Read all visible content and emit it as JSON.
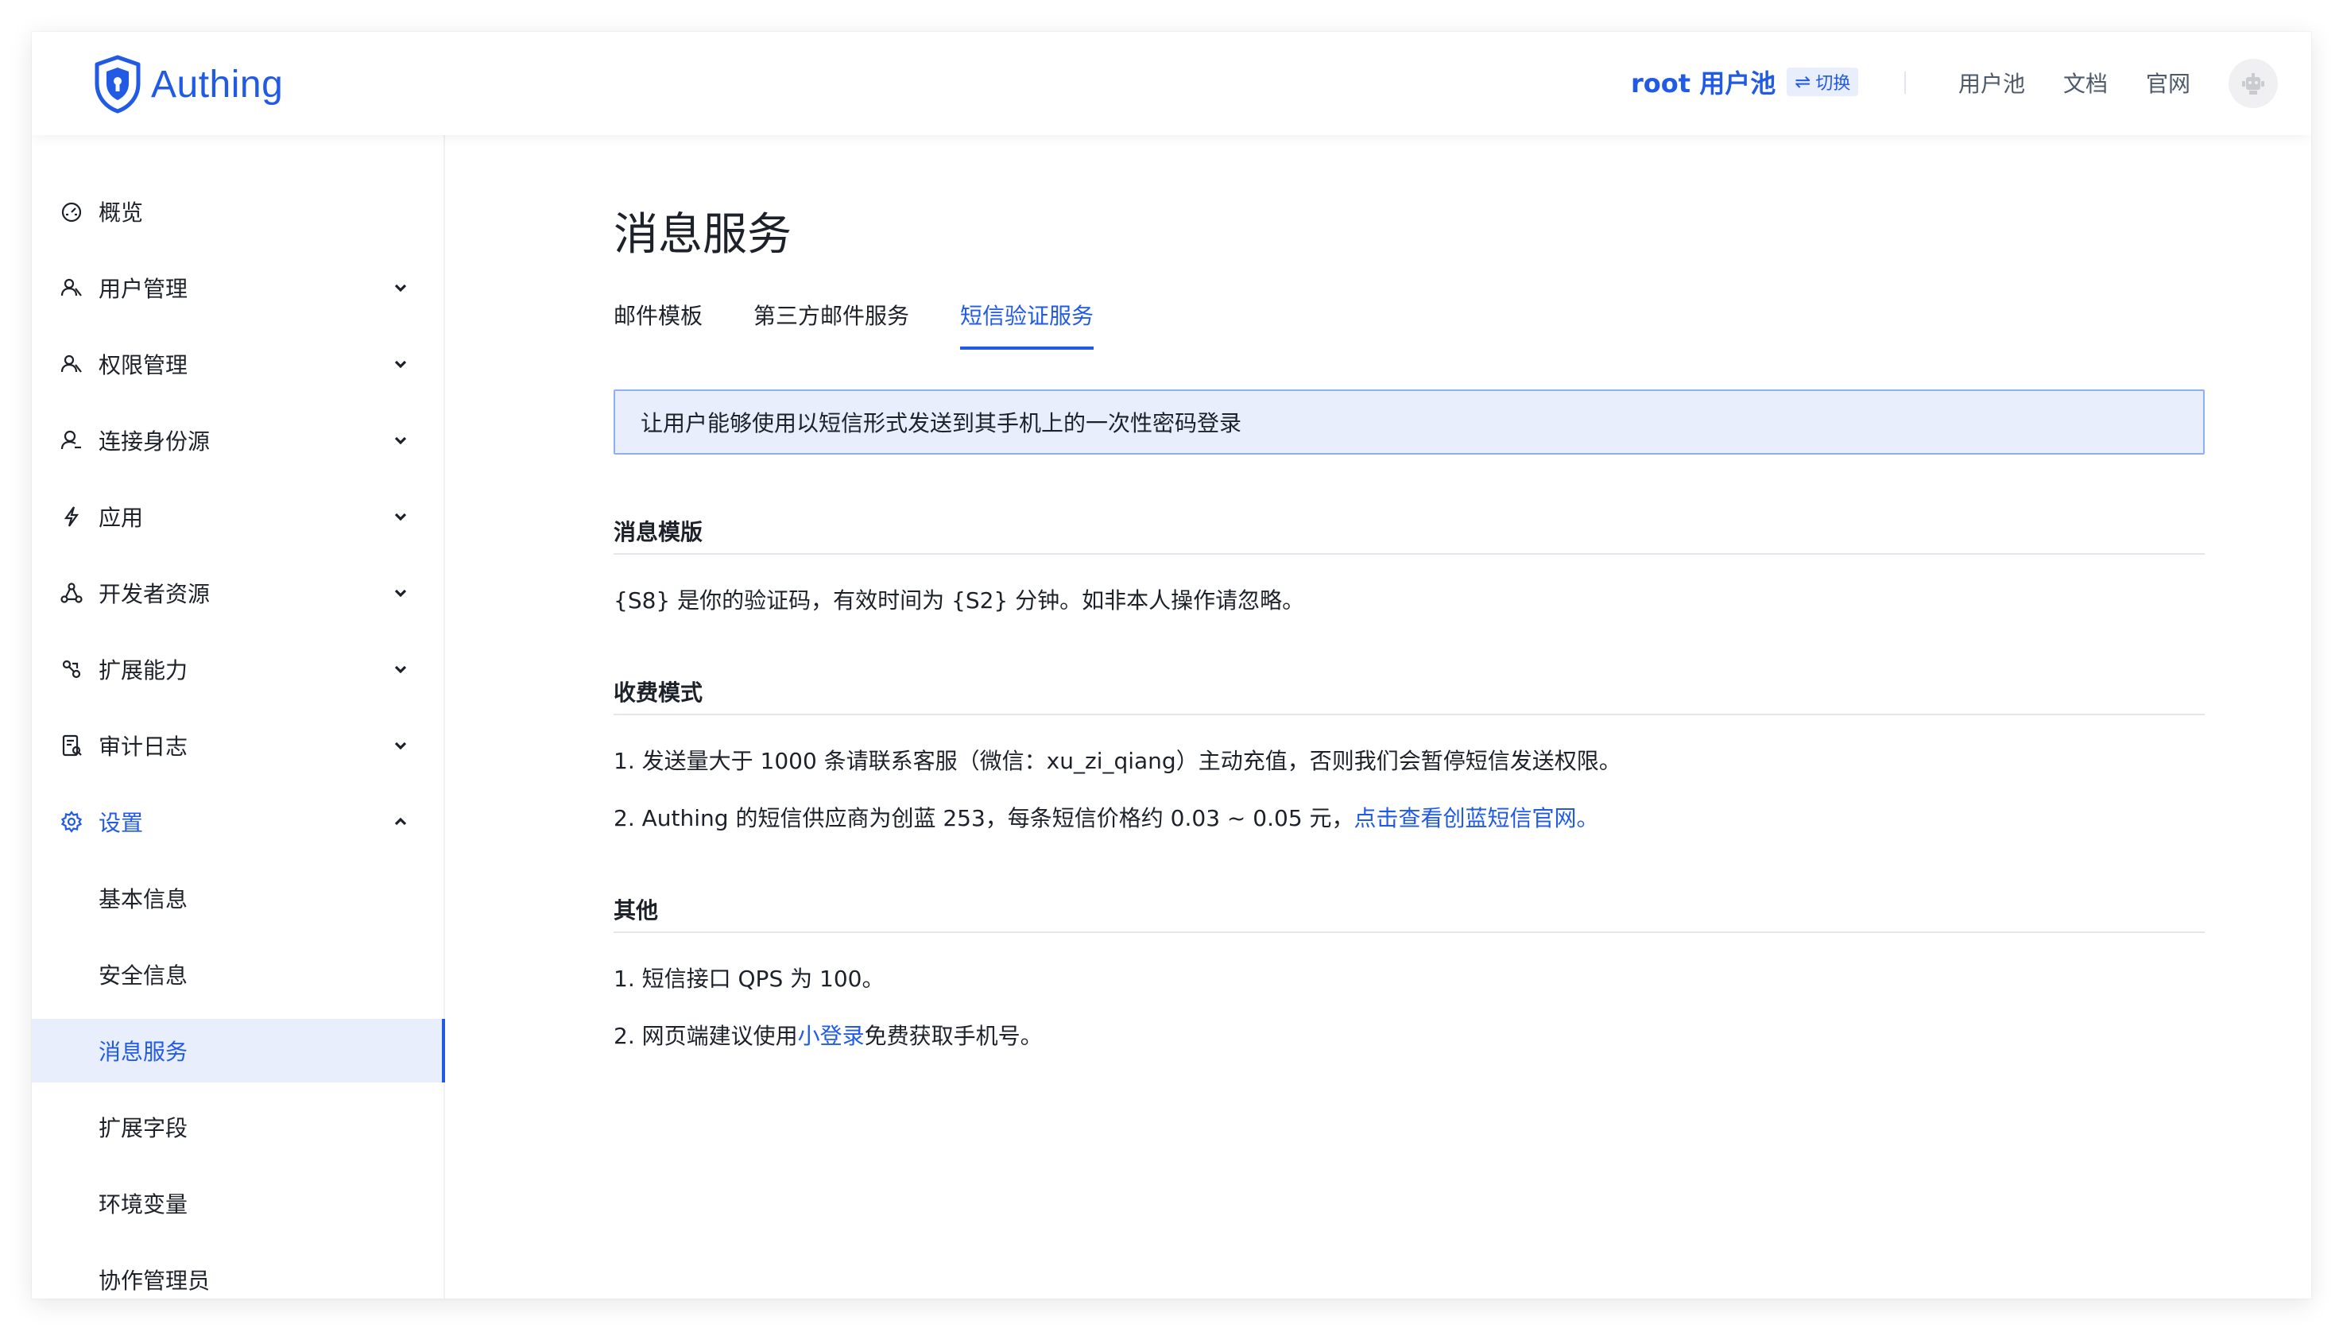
{
  "header": {
    "logo_text": "Authing",
    "pool_name": "root 用户池",
    "switch_label": "切换",
    "switch_icon": "⇌",
    "links": [
      "用户池",
      "文档",
      "官网"
    ]
  },
  "sidebar": {
    "items": [
      {
        "label": "概览",
        "icon": "dashboard-icon"
      },
      {
        "label": "用户管理",
        "icon": "users-icon"
      },
      {
        "label": "权限管理",
        "icon": "permission-icon"
      },
      {
        "label": "连接身份源",
        "icon": "identity-source-icon"
      },
      {
        "label": "应用",
        "icon": "lightning-icon"
      },
      {
        "label": "开发者资源",
        "icon": "developer-icon"
      },
      {
        "label": "扩展能力",
        "icon": "extension-icon"
      },
      {
        "label": "审计日志",
        "icon": "audit-log-icon"
      },
      {
        "label": "设置",
        "icon": "gear-icon"
      }
    ],
    "sub_items": [
      "基本信息",
      "安全信息",
      "消息服务",
      "扩展字段",
      "环境变量",
      "协作管理员"
    ]
  },
  "main": {
    "title": "消息服务",
    "tabs": [
      "邮件模板",
      "第三方邮件服务",
      "短信验证服务"
    ],
    "alert": "让用户能够使用以短信形式发送到其手机上的一次性密码登录",
    "sections": {
      "template": {
        "title": "消息模版",
        "text": "{S8} 是你的验证码，有效时间为 {S2} 分钟。如非本人操作请忽略。"
      },
      "billing": {
        "title": "收费模式",
        "item1": "1. 发送量大于 1000 条请联系客服（微信：xu_zi_qiang）主动充值，否则我们会暂停短信发送权限。",
        "item2_prefix": "2. Authing 的短信供应商为创蓝 253，每条短信价格约 0.03 ~ 0.05 元，",
        "item2_link": "点击查看创蓝短信官网。"
      },
      "other": {
        "title": "其他",
        "item1": "1. 短信接口 QPS 为 100。",
        "item2_prefix": "2. 网页端建议使用",
        "item2_link": "小登录",
        "item2_suffix": "免费获取手机号。"
      }
    }
  },
  "colors": {
    "accent": "#215ae5",
    "alert_bg": "#e8eefc",
    "text": "#1d2129"
  }
}
